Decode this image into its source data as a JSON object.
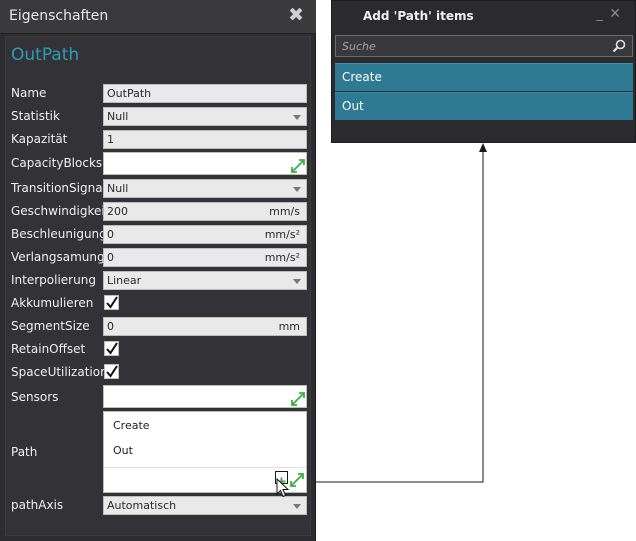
{
  "panel": {
    "title": "Eigenschaften",
    "close_symbol": "✖",
    "object_name": "OutPath"
  },
  "properties": {
    "name": {
      "label": "Name",
      "value": "OutPath"
    },
    "statistik": {
      "label": "Statistik",
      "value": "Null"
    },
    "kapazitaet": {
      "label": "Kapazität",
      "value": "1"
    },
    "capacity_blocks": {
      "label": "CapacityBlocks"
    },
    "transition_signal": {
      "label": "TransitionSignal",
      "value": "Null"
    },
    "geschwindigkeit": {
      "label": "Geschwindigkeit",
      "value": "200",
      "unit": "mm/s"
    },
    "beschleunigung": {
      "label": "Beschleunigung",
      "value": "0",
      "unit": "mm/s²"
    },
    "verlangsamung": {
      "label": "Verlangsamung",
      "value": "0",
      "unit": "mm/s²"
    },
    "interpolierung": {
      "label": "Interpolierung",
      "value": "Linear"
    },
    "akkumulieren": {
      "label": "Akkumulieren",
      "checked": true
    },
    "segment_size": {
      "label": "SegmentSize",
      "value": "0",
      "unit": "mm"
    },
    "retain_offset": {
      "label": "RetainOffset",
      "checked": true
    },
    "space_utilization": {
      "label": "SpaceUtilization",
      "checked": true
    },
    "sensors": {
      "label": "Sensors"
    },
    "path": {
      "label": "Path",
      "items": [
        "Create",
        "Out"
      ],
      "add_symbol": "+"
    },
    "path_axis": {
      "label": "pathAxis",
      "value": "Automatisch"
    }
  },
  "popup": {
    "title": "Add 'Path' items",
    "minimize_symbol": "_",
    "close_symbol": "✕",
    "search_placeholder": "Suche",
    "items": [
      "Create",
      "Out"
    ]
  },
  "colors": {
    "accent": "#2e9bb5",
    "selected_item": "#2e7a93",
    "expand_icon": "#3cb043"
  }
}
